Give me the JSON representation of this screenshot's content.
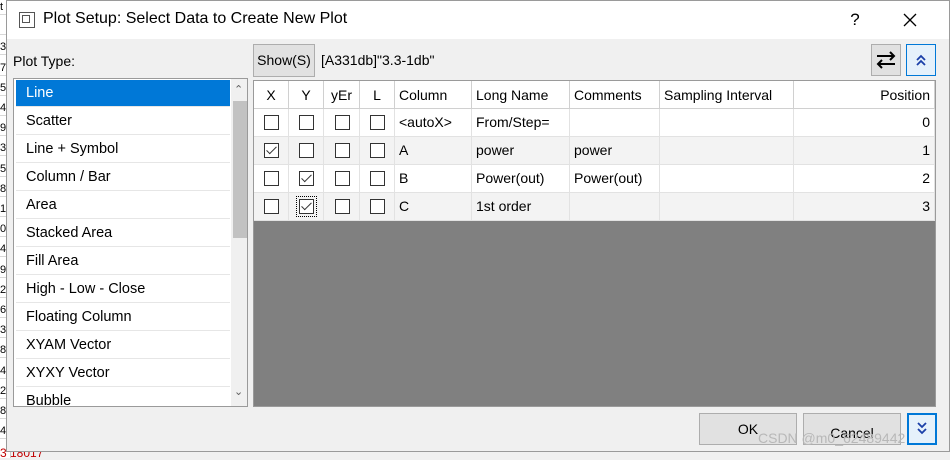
{
  "background": {
    "cells": [
      "t",
      "",
      "3.",
      "7.",
      "5.",
      "4.",
      "9.",
      "3.",
      "5.",
      "8.",
      "1.",
      "0.",
      "4.",
      "9.",
      "2.",
      "6.",
      "3.",
      "8.",
      "4.",
      "2.",
      "8.",
      "4."
    ],
    "bottom_value": "3 18017"
  },
  "dialog": {
    "title": "Plot Setup: Select Data to Create New Plot",
    "help_label": "?",
    "plot_type_label": "Plot Type:",
    "plot_types": [
      "Line",
      "Scatter",
      "Line + Symbol",
      "Column / Bar",
      "Area",
      "Stacked Area",
      "Fill Area",
      "High - Low - Close",
      "Floating Column",
      "XYAM Vector",
      "XYXY Vector",
      "Bubble"
    ],
    "selected_plot_type": "Line",
    "show_button": "Show(S)",
    "dataset": "[A331db]\"3.3-1db\"",
    "columns": [
      "X",
      "Y",
      "yEr",
      "L",
      "Column",
      "Long Name",
      "Comments",
      "Sampling Interval",
      "Position"
    ],
    "rows": [
      {
        "x": false,
        "y": false,
        "yer": false,
        "l": false,
        "column": "<autoX>",
        "long_name": "From/Step=",
        "comments": "",
        "sampling": "",
        "position": "0"
      },
      {
        "x": true,
        "y": false,
        "yer": false,
        "l": false,
        "column": "A",
        "long_name": "power",
        "comments": "power",
        "sampling": "",
        "position": "1"
      },
      {
        "x": false,
        "y": true,
        "yer": false,
        "l": false,
        "column": "B",
        "long_name": "Power(out)",
        "comments": "Power(out)",
        "sampling": "",
        "position": "2"
      },
      {
        "x": false,
        "y": true,
        "yer": false,
        "l": false,
        "column": "C",
        "long_name": "1st order",
        "comments": "",
        "sampling": "",
        "position": "3"
      }
    ],
    "ok_label": "OK",
    "cancel_label": "Cancel"
  },
  "watermark": "CSDN @m0_62489442"
}
